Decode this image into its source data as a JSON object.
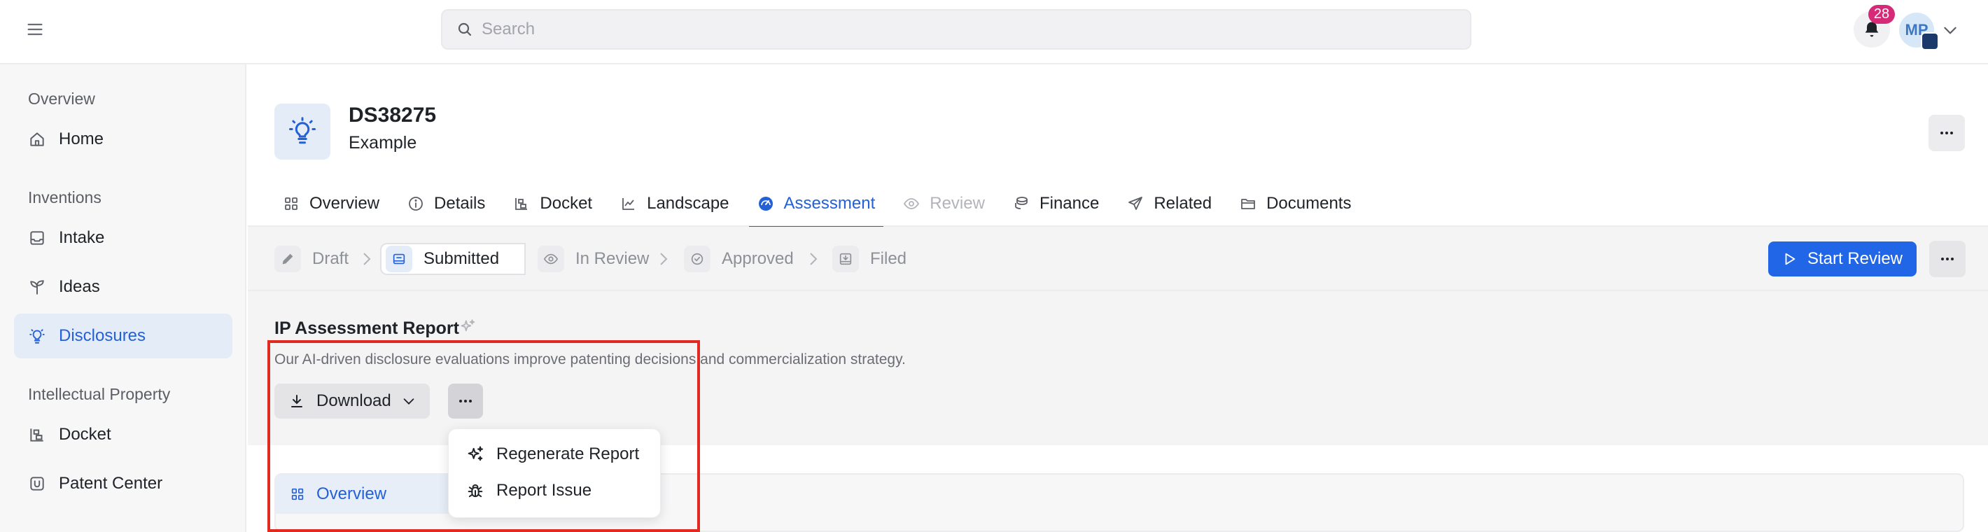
{
  "search": {
    "placeholder": "Search"
  },
  "header": {
    "notifications_count": "28",
    "avatar_initials": "MP"
  },
  "sidebar": {
    "sections": [
      {
        "label": "Overview",
        "items": [
          {
            "label": "Home",
            "icon": "home-icon"
          }
        ]
      },
      {
        "label": "Inventions",
        "items": [
          {
            "label": "Intake",
            "icon": "inbox-icon"
          },
          {
            "label": "Ideas",
            "icon": "sprout-icon"
          },
          {
            "label": "Disclosures",
            "icon": "lightbulb-icon",
            "active": true
          }
        ]
      },
      {
        "label": "Intellectual Property",
        "items": [
          {
            "label": "Docket",
            "icon": "docket-icon"
          },
          {
            "label": "Patent Center",
            "icon": "patent-center-icon"
          }
        ]
      }
    ]
  },
  "record": {
    "id": "DS38275",
    "subtitle": "Example"
  },
  "tabs": [
    {
      "label": "Overview",
      "icon": "grid-icon"
    },
    {
      "label": "Details",
      "icon": "info-icon"
    },
    {
      "label": "Docket",
      "icon": "docket-icon"
    },
    {
      "label": "Landscape",
      "icon": "chart-line-icon"
    },
    {
      "label": "Assessment",
      "icon": "gauge-icon",
      "active": true
    },
    {
      "label": "Review",
      "icon": "eye-icon",
      "disabled": true
    },
    {
      "label": "Finance",
      "icon": "coins-icon"
    },
    {
      "label": "Related",
      "icon": "send-icon"
    },
    {
      "label": "Documents",
      "icon": "folder-icon"
    }
  ],
  "status_steps": [
    {
      "label": "Draft",
      "icon": "pencil-icon"
    },
    {
      "label": "Submitted",
      "icon": "submitted-icon",
      "current": true
    },
    {
      "label": "In Review",
      "icon": "eye-icon"
    },
    {
      "label": "Approved",
      "icon": "check-circle-icon"
    },
    {
      "label": "Filed",
      "icon": "filed-icon"
    }
  ],
  "status_actions": {
    "start_review_label": "Start Review"
  },
  "report": {
    "title": "IP Assessment Report",
    "description": "Our AI-driven disclosure evaluations improve patenting decisions and commercialization strategy.",
    "download_label": "Download",
    "menu": [
      {
        "label": "Regenerate Report",
        "icon": "sparkles-icon"
      },
      {
        "label": "Report Issue",
        "icon": "bug-icon"
      }
    ],
    "overview_tab_label": "Overview"
  },
  "colors": {
    "accent": "#2166e6",
    "badge": "#d62a79",
    "highlight": "#e02a22"
  }
}
